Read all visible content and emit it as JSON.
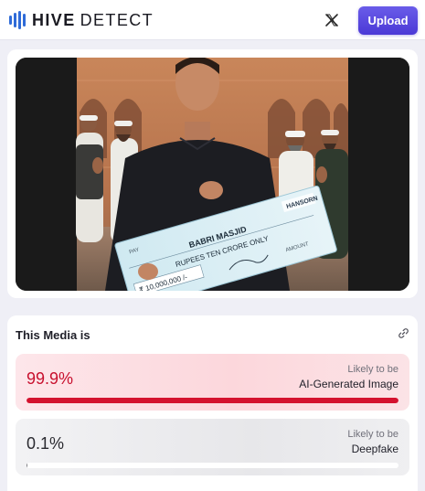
{
  "brand": {
    "name_bold": "HIVE",
    "name_light": "DETECT",
    "accent": "#2f6bd8"
  },
  "header": {
    "x_icon": "x-logo-icon",
    "upload_label": "Upload",
    "upload_color": "#5a49e0"
  },
  "media": {
    "cheque_text": {
      "brand": "HANSORN",
      "payee": "BABRI MASJID",
      "amount_words": "RUPEES TEN CRORE ONLY",
      "amount": "₹ 10,000,000 /-",
      "label_payee": "PAY",
      "label_amount": "AMOUNT"
    }
  },
  "result": {
    "title": "This Media is",
    "link_icon": "link-icon",
    "rows": [
      {
        "percent_text": "99.9%",
        "value": 0.999,
        "likely": "Likely to be",
        "label": "AI-Generated Image",
        "color": "#d4122e"
      },
      {
        "percent_text": "0.1%",
        "value": 0.001,
        "likely": "Likely to be",
        "label": "Deepfake",
        "color": "#7a7a80"
      }
    ]
  }
}
